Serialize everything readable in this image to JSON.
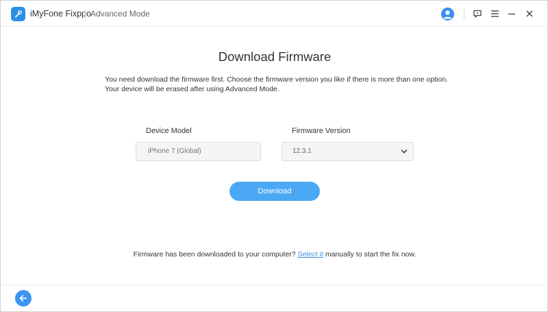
{
  "titlebar": {
    "app_name": "iMyFone Fixppo",
    "mode": "Advanced Mode"
  },
  "icons": {
    "logo": "wrench-app-icon",
    "account": "user-avatar-icon",
    "feedback": "chat-bubble-icon",
    "menu": "hamburger-menu-icon",
    "minimize": "minimize-icon",
    "close": "close-icon",
    "dropdown": "chevron-down-icon",
    "back": "arrow-left-icon"
  },
  "main": {
    "title": "Download Firmware",
    "description_line1": "You need download the firmware first. Choose the firmware version you like if there is more than one option.",
    "description_line2": "Your device will be erased after using Advanced Mode.",
    "device_model_label": "Device Model",
    "device_model_value": "iPhone 7 (Global)",
    "firmware_version_label": "Firmware Version",
    "firmware_version_value": "12.3.1",
    "download_button": "Download"
  },
  "footer": {
    "prefix": "Firmware has been downloaded to your computer? ",
    "link": "Select it",
    "suffix": " manually to start the fix now."
  },
  "colors": {
    "accent": "#4ba8f5",
    "link": "#3a90e6",
    "logo": "#2f8fe6"
  }
}
